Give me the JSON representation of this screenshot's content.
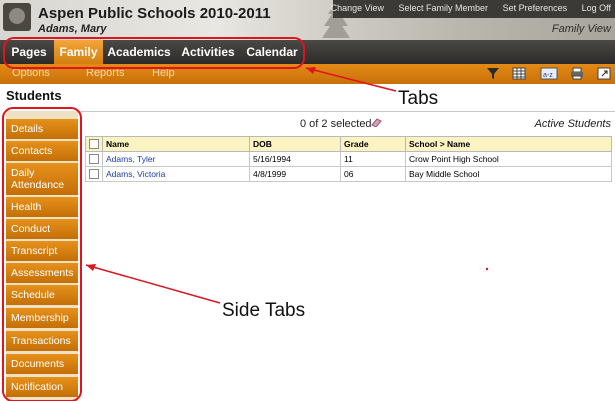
{
  "header": {
    "school_name": "Aspen Public Schools 2010-2011",
    "user_name": "Adams, Mary",
    "top_links": [
      "Change View",
      "Select Family Member",
      "Set Preferences",
      "Log Off"
    ],
    "view_label": "Family View"
  },
  "tabs": [
    {
      "label": "Pages",
      "active": false
    },
    {
      "label": "Family",
      "active": true
    },
    {
      "label": "Academics",
      "active": false
    },
    {
      "label": "Activities",
      "active": false
    },
    {
      "label": "Calendar",
      "active": false
    }
  ],
  "subnav": {
    "options": "Options",
    "reports": "Reports",
    "help": "Help",
    "icons": [
      "filter-icon",
      "grid-icon",
      "sort-az-icon",
      "print-icon",
      "popup-icon"
    ]
  },
  "page_title": "Students",
  "side_tabs": [
    "Details",
    "Contacts",
    "Daily Attendance",
    "Health",
    "Conduct",
    "Transcript",
    "Assessments",
    "Schedule",
    "Membership",
    "Transactions",
    "Documents",
    "Notification"
  ],
  "list": {
    "selected_text": "0 of 2 selected",
    "filter_label": "Active Students",
    "columns": [
      "Name",
      "DOB",
      "Grade",
      "School > Name"
    ],
    "rows": [
      {
        "name": "Adams, Tyler",
        "dob": "5/16/1994",
        "grade": "11",
        "school": "Crow Point High School"
      },
      {
        "name": "Adams, Victoria",
        "dob": "4/8/1999",
        "grade": "06",
        "school": "Bay Middle School"
      }
    ]
  },
  "annotations": {
    "tabs": "Tabs",
    "side_tabs": "Side Tabs"
  },
  "colors": {
    "accent_orange": "#d27f0f",
    "tab_bar": "#2d2b29",
    "annotation_red": "#e0141e",
    "header_row": "#fbf3c2"
  }
}
